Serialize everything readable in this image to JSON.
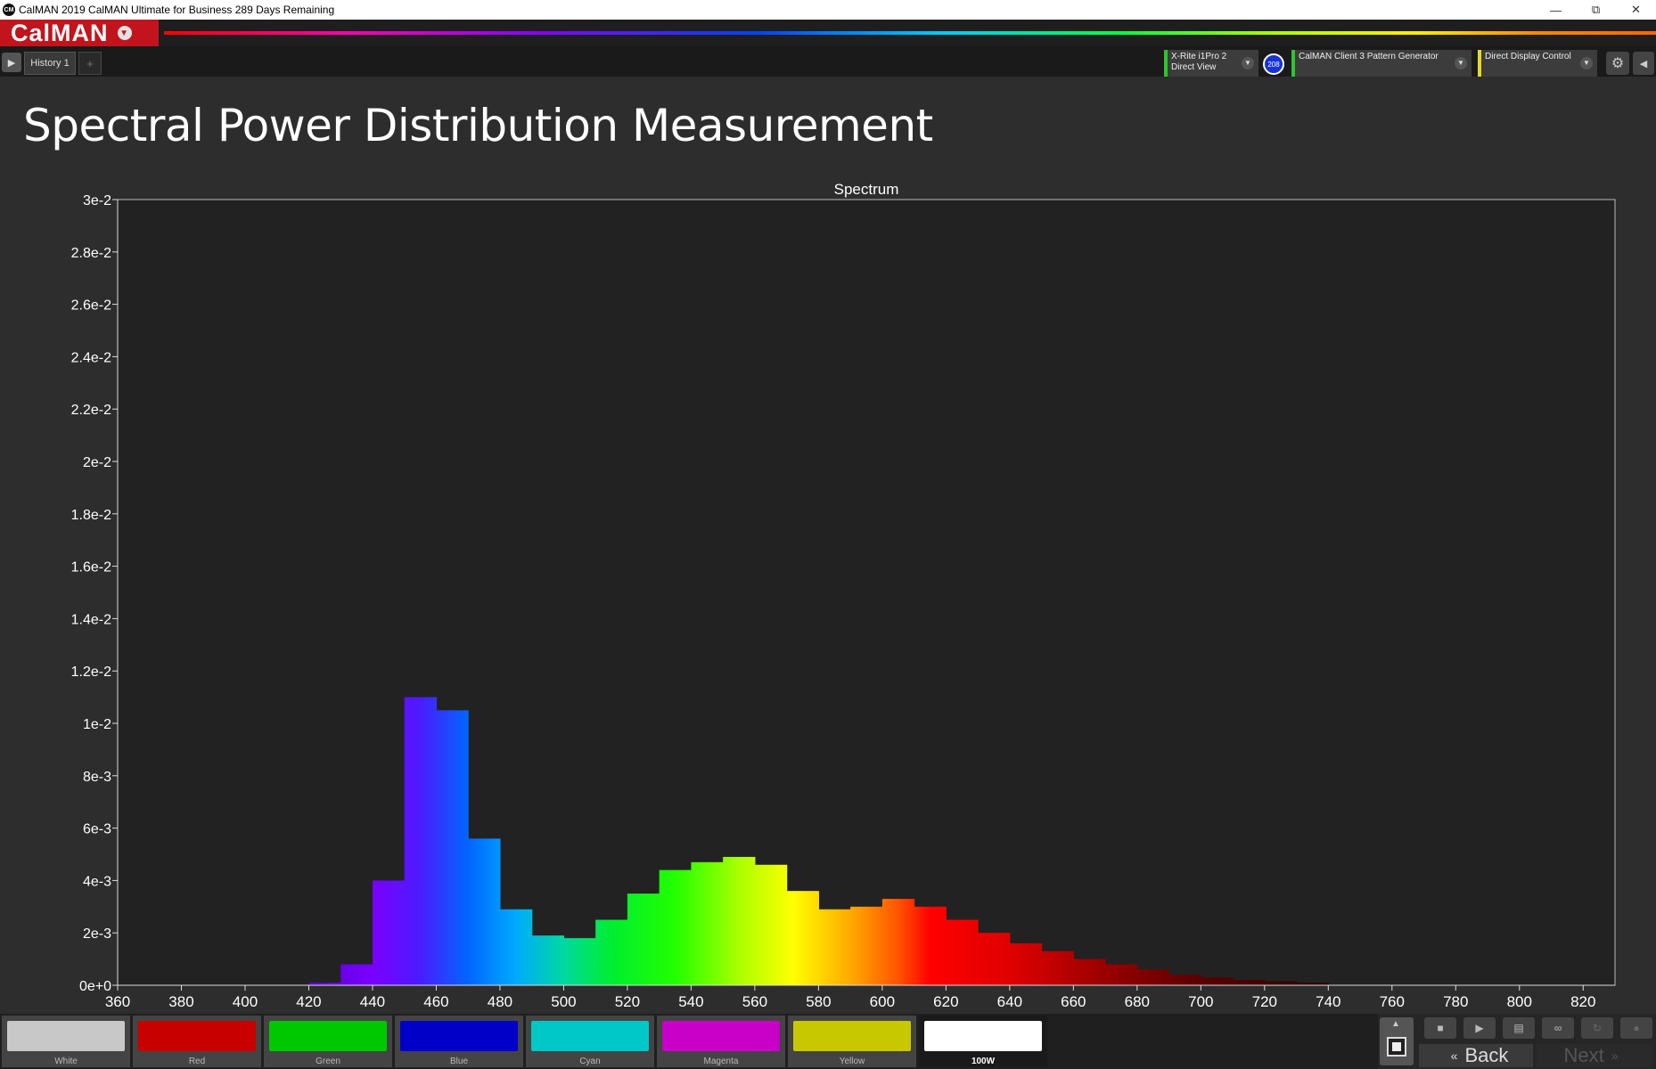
{
  "window": {
    "app_icon": "CM",
    "title": "CalMAN 2019 CalMAN Ultimate for Business 289 Days Remaining",
    "minimize_icon": "minimize-icon",
    "restore_icon": "restore-icon",
    "close_icon": "close-icon"
  },
  "brand": {
    "logo": "CalMAN",
    "logo_color": "#c1141c"
  },
  "toolbar": {
    "history_tab": "History 1",
    "add_tab": "+",
    "meter": {
      "line1": "X-Rite i1Pro 2",
      "line2": "Direct View",
      "badge": "208"
    },
    "generator": {
      "line1": "CalMAN Client 3 Pattern Generator"
    },
    "display": {
      "line1": "Direct Display Control"
    }
  },
  "page": {
    "title": "Spectral Power Distribution Measurement"
  },
  "chart_data": {
    "type": "bar",
    "title": "Spectrum",
    "xlabel": "",
    "ylabel": "",
    "xlim": [
      360,
      830
    ],
    "ylim": [
      0,
      0.03
    ],
    "x_ticks": [
      "360",
      "380",
      "400",
      "420",
      "440",
      "460",
      "480",
      "500",
      "520",
      "540",
      "560",
      "580",
      "600",
      "620",
      "640",
      "660",
      "680",
      "700",
      "720",
      "740",
      "760",
      "780",
      "800",
      "820"
    ],
    "y_ticks": [
      "0e+0",
      "2e-3",
      "4e-3",
      "6e-3",
      "8e-3",
      "1e-2",
      "1.2e-2",
      "1.4e-2",
      "1.6e-2",
      "1.8e-2",
      "2e-2",
      "2.2e-2",
      "2.4e-2",
      "2.6e-2",
      "2.8e-2",
      "3e-2"
    ],
    "bin_width": 10,
    "bins": [
      {
        "x": 420,
        "y": 0.0001
      },
      {
        "x": 430,
        "y": 0.0008
      },
      {
        "x": 440,
        "y": 0.004
      },
      {
        "x": 450,
        "y": 0.011
      },
      {
        "x": 460,
        "y": 0.0105
      },
      {
        "x": 470,
        "y": 0.0056
      },
      {
        "x": 480,
        "y": 0.0029
      },
      {
        "x": 490,
        "y": 0.0019
      },
      {
        "x": 500,
        "y": 0.0018
      },
      {
        "x": 510,
        "y": 0.0025
      },
      {
        "x": 520,
        "y": 0.0035
      },
      {
        "x": 530,
        "y": 0.0044
      },
      {
        "x": 540,
        "y": 0.0047
      },
      {
        "x": 550,
        "y": 0.0049
      },
      {
        "x": 560,
        "y": 0.0046
      },
      {
        "x": 570,
        "y": 0.0036
      },
      {
        "x": 580,
        "y": 0.0029
      },
      {
        "x": 590,
        "y": 0.003
      },
      {
        "x": 600,
        "y": 0.0033
      },
      {
        "x": 610,
        "y": 0.003
      },
      {
        "x": 620,
        "y": 0.0025
      },
      {
        "x": 630,
        "y": 0.002
      },
      {
        "x": 640,
        "y": 0.0016
      },
      {
        "x": 650,
        "y": 0.0013
      },
      {
        "x": 660,
        "y": 0.001
      },
      {
        "x": 670,
        "y": 0.0008
      },
      {
        "x": 680,
        "y": 0.0006
      },
      {
        "x": 690,
        "y": 0.0004
      },
      {
        "x": 700,
        "y": 0.0003
      },
      {
        "x": 710,
        "y": 0.0002
      },
      {
        "x": 720,
        "y": 0.00015
      },
      {
        "x": 730,
        "y": 0.0001
      }
    ],
    "grid": false,
    "legend": "none"
  },
  "swatches": [
    {
      "label": "White",
      "color": "#c8c8c8"
    },
    {
      "label": "Red",
      "color": "#c80000"
    },
    {
      "label": "Green",
      "color": "#00c800"
    },
    {
      "label": "Blue",
      "color": "#0000c8"
    },
    {
      "label": "Cyan",
      "color": "#00c8c8"
    },
    {
      "label": "Magenta",
      "color": "#c800c8"
    },
    {
      "label": "Yellow",
      "color": "#c8c800"
    },
    {
      "label": "100W",
      "color": "#ffffff"
    }
  ],
  "nav": {
    "back": "Back",
    "next": "Next"
  }
}
